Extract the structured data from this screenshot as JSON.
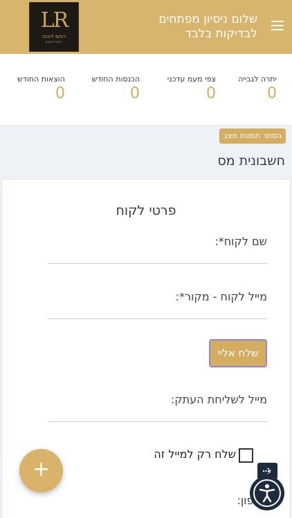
{
  "header": {
    "greeting": "שלום ניסיון מפתחים",
    "subtitle": "לבדיקות בלבד",
    "logo_monogram": "LR",
    "logo_name": "רותם ליבנה",
    "logo_subtitle": "רואת חשבון",
    "menu_icon": "hamburger-menu-icon"
  },
  "stats": [
    {
      "label": "יתרה לגבייה",
      "value": "0"
    },
    {
      "label": "צפי מעמ עדכני",
      "value": "0"
    },
    {
      "label": "הכנסות החודש",
      "value": "0"
    },
    {
      "label": "הוצאות החודש",
      "value": "0"
    }
  ],
  "hide_status_button": "הסתר תמונת מצב",
  "section_title": "חשבונית מס",
  "form": {
    "title": "פרטי לקוח",
    "customer_name_label": "שם לקוח*:",
    "customer_email_label": "מייל לקוח - מקור*:",
    "send_to_me_button": "שלח אליי",
    "copy_email_label": "מייל לשליחת העתק:",
    "send_only_label": "שלח רק למייל זה",
    "phone_label": "טלפון:"
  },
  "fab_icon": "plus-icon",
  "accessibility": {
    "toggle_icon": "arrow-right-icon",
    "button_icon": "accessibility-icon"
  },
  "colors": {
    "brand_gold": "#d8b56d",
    "accent_gold": "#d4ad61",
    "navy": "#1d2b3d"
  }
}
